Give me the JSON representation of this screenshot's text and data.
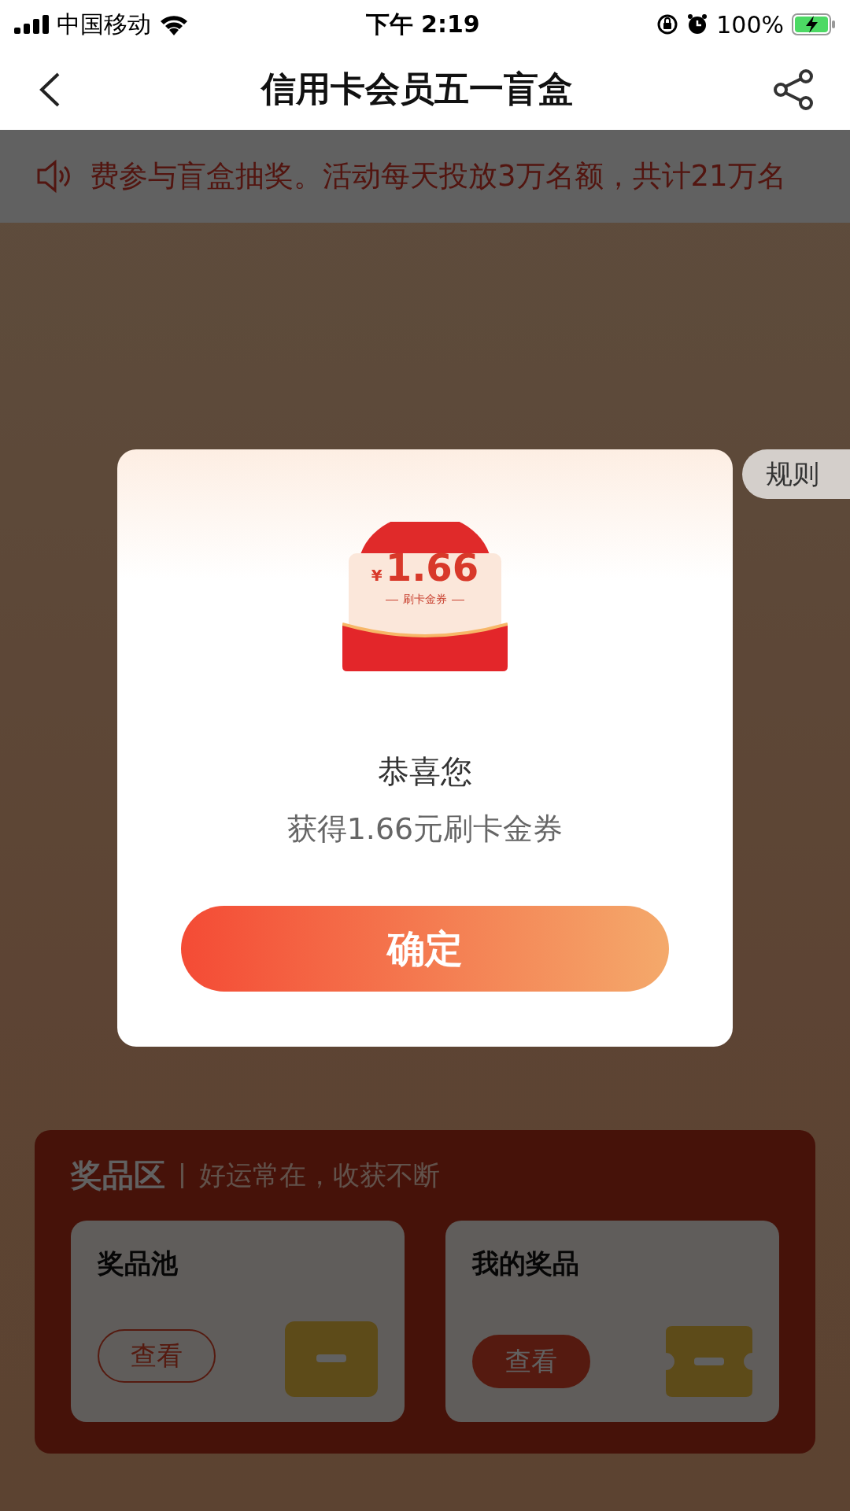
{
  "status_bar": {
    "carrier": "中国移动",
    "time": "下午 2:19",
    "battery": "100%"
  },
  "nav": {
    "title": "信用卡会员五一盲盒"
  },
  "notice": {
    "text": "费参与盲盒抽奖。活动每天投放3万名额，共计21万名"
  },
  "rules_tab": {
    "label": "规则"
  },
  "prize_area": {
    "title": "奖品区",
    "subtitle": "好运常在，收获不断",
    "cards": [
      {
        "title": "奖品池",
        "button": "查看",
        "kind": "outline"
      },
      {
        "title": "我的奖品",
        "button": "查看",
        "kind": "filled"
      }
    ]
  },
  "dialog": {
    "coupon": {
      "currency": "¥",
      "amount": "1.66",
      "label": "刷卡金券"
    },
    "title": "恭喜您",
    "message": "获得1.66元刷卡金券",
    "button": "确定"
  }
}
